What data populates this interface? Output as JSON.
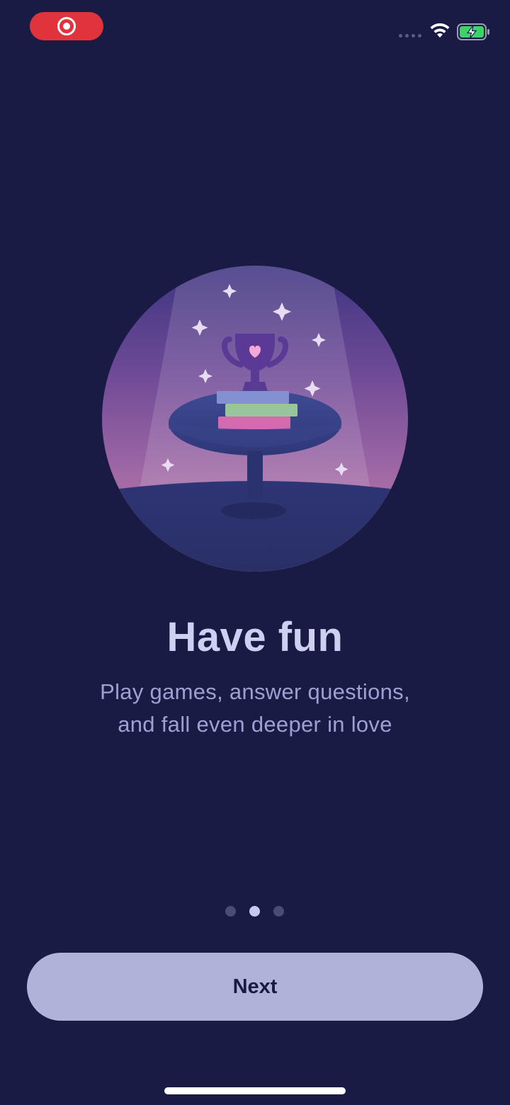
{
  "status_bar": {
    "recording_icon": "screen-record-icon",
    "wifi_icon": "wifi-icon",
    "battery_icon": "battery-charging-icon",
    "record_color": "#e0333c"
  },
  "onboarding": {
    "illustration_icon": "trophy-on-table-illustration",
    "title": "Have fun",
    "subtitle_line1": "Play games, answer questions,",
    "subtitle_line2": "and fall even deeper in love",
    "pager": {
      "total": 3,
      "active_index": 1
    },
    "next_label": "Next"
  },
  "colors": {
    "background": "#1a1b45",
    "button": "#b0b2da",
    "title": "#cdd0f0",
    "subtitle": "#9ea1cf"
  }
}
